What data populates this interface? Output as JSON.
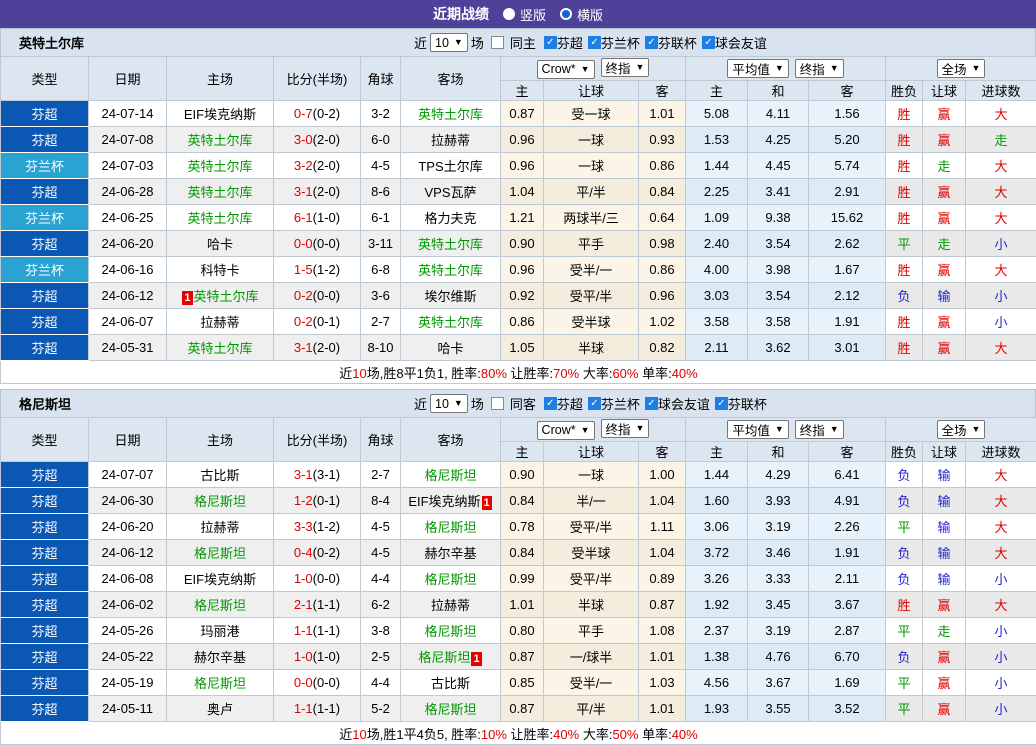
{
  "titlebar": {
    "title": "近期战绩",
    "options": [
      {
        "label": "竖版",
        "selected": false
      },
      {
        "label": "横版",
        "selected": true
      }
    ]
  },
  "colors": {
    "titlebar_purple": "#4e4199",
    "league_super_blue": "#0b57b4",
    "league_cup_blue": "#2aa3d2",
    "focus_team_green": "#009900",
    "win_red": "#e00000",
    "draw_green": "#009900",
    "lose_blue": "#2222cc",
    "checkbox_blue": "#1d7fe3"
  },
  "columns": {
    "type": "类型",
    "date": "日期",
    "home": "主场",
    "score": "比分(半场)",
    "corner": "角球",
    "away": "客场",
    "odds_sub": [
      "主",
      "让球",
      "客"
    ],
    "avg_sub": [
      "主",
      "和",
      "客"
    ],
    "result_sub": [
      "胜负",
      "让球",
      "进球数"
    ]
  },
  "selects": {
    "bookmaker": "Crow*",
    "final": "终指",
    "average": "平均值",
    "scope": "全场"
  },
  "sections": [
    {
      "team": "英特土尔库",
      "filter": {
        "near": "近",
        "count": "10",
        "games": "场",
        "same": "同主",
        "leagues": [
          "芬超",
          "芬兰杯",
          "芬联杯",
          "球会友谊"
        ]
      },
      "rows": [
        {
          "lg": "芬超",
          "cup": false,
          "date": "24-07-14",
          "home": {
            "n": "EIF埃克纳斯",
            "g": false
          },
          "score": "0-7",
          "half": "(0-2)",
          "corner": "3-2",
          "away": {
            "n": "英特土尔库",
            "g": true
          },
          "o": [
            "0.87",
            "受一球",
            "1.01"
          ],
          "a": [
            "5.08",
            "4.11",
            "1.56"
          ],
          "res": [
            [
              "胜",
              "r"
            ],
            [
              "赢",
              "r"
            ],
            [
              "大",
              "r"
            ]
          ]
        },
        {
          "lg": "芬超",
          "cup": false,
          "date": "24-07-08",
          "home": {
            "n": "英特土尔库",
            "g": true
          },
          "score": "3-0",
          "half": "(2-0)",
          "corner": "6-0",
          "away": {
            "n": "拉赫蒂",
            "g": false
          },
          "o": [
            "0.96",
            "一球",
            "0.93"
          ],
          "a": [
            "1.53",
            "4.25",
            "5.20"
          ],
          "res": [
            [
              "胜",
              "r"
            ],
            [
              "赢",
              "r"
            ],
            [
              "走",
              "g"
            ]
          ]
        },
        {
          "lg": "芬兰杯",
          "cup": true,
          "date": "24-07-03",
          "home": {
            "n": "英特土尔库",
            "g": true
          },
          "score": "3-2",
          "half": "(2-0)",
          "corner": "4-5",
          "away": {
            "n": "TPS土尔库",
            "g": false
          },
          "o": [
            "0.96",
            "一球",
            "0.86"
          ],
          "a": [
            "1.44",
            "4.45",
            "5.74"
          ],
          "res": [
            [
              "胜",
              "r"
            ],
            [
              "走",
              "g"
            ],
            [
              "大",
              "r"
            ]
          ]
        },
        {
          "lg": "芬超",
          "cup": false,
          "date": "24-06-28",
          "home": {
            "n": "英特土尔库",
            "g": true
          },
          "score": "3-1",
          "half": "(2-0)",
          "corner": "8-6",
          "away": {
            "n": "VPS瓦萨",
            "g": false
          },
          "o": [
            "1.04",
            "平/半",
            "0.84"
          ],
          "a": [
            "2.25",
            "3.41",
            "2.91"
          ],
          "res": [
            [
              "胜",
              "r"
            ],
            [
              "赢",
              "r"
            ],
            [
              "大",
              "r"
            ]
          ]
        },
        {
          "lg": "芬兰杯",
          "cup": true,
          "date": "24-06-25",
          "home": {
            "n": "英特土尔库",
            "g": true
          },
          "score": "6-1",
          "half": "(1-0)",
          "corner": "6-1",
          "away": {
            "n": "格力夫克",
            "g": false
          },
          "o": [
            "1.21",
            "两球半/三",
            "0.64"
          ],
          "a": [
            "1.09",
            "9.38",
            "15.62"
          ],
          "res": [
            [
              "胜",
              "r"
            ],
            [
              "赢",
              "r"
            ],
            [
              "大",
              "r"
            ]
          ]
        },
        {
          "lg": "芬超",
          "cup": false,
          "date": "24-06-20",
          "home": {
            "n": "哈卡",
            "g": false
          },
          "score": "0-0",
          "half": "(0-0)",
          "corner": "3-11",
          "away": {
            "n": "英特土尔库",
            "g": true
          },
          "o": [
            "0.90",
            "平手",
            "0.98"
          ],
          "a": [
            "2.40",
            "3.54",
            "2.62"
          ],
          "res": [
            [
              "平",
              "g"
            ],
            [
              "走",
              "g"
            ],
            [
              "小",
              "b"
            ]
          ]
        },
        {
          "lg": "芬兰杯",
          "cup": true,
          "date": "24-06-16",
          "home": {
            "n": "科特卡",
            "g": false
          },
          "score": "1-5",
          "half": "(1-2)",
          "corner": "6-8",
          "away": {
            "n": "英特土尔库",
            "g": true
          },
          "o": [
            "0.96",
            "受半/一",
            "0.86"
          ],
          "a": [
            "4.00",
            "3.98",
            "1.67"
          ],
          "res": [
            [
              "胜",
              "r"
            ],
            [
              "赢",
              "r"
            ],
            [
              "大",
              "r"
            ]
          ]
        },
        {
          "lg": "芬超",
          "cup": false,
          "date": "24-06-12",
          "home": {
            "n": "英特土尔库",
            "g": true,
            "card": "1",
            "cpos": "b"
          },
          "score": "0-2",
          "half": "(0-0)",
          "corner": "3-6",
          "away": {
            "n": "埃尔维斯",
            "g": false
          },
          "o": [
            "0.92",
            "受平/半",
            "0.96"
          ],
          "a": [
            "3.03",
            "3.54",
            "2.12"
          ],
          "res": [
            [
              "负",
              "b"
            ],
            [
              "输",
              "b"
            ],
            [
              "小",
              "b"
            ]
          ]
        },
        {
          "lg": "芬超",
          "cup": false,
          "date": "24-06-07",
          "home": {
            "n": "拉赫蒂",
            "g": false
          },
          "score": "0-2",
          "half": "(0-1)",
          "corner": "2-7",
          "away": {
            "n": "英特土尔库",
            "g": true
          },
          "o": [
            "0.86",
            "受半球",
            "1.02"
          ],
          "a": [
            "3.58",
            "3.58",
            "1.91"
          ],
          "res": [
            [
              "胜",
              "r"
            ],
            [
              "赢",
              "r"
            ],
            [
              "小",
              "b"
            ]
          ]
        },
        {
          "lg": "芬超",
          "cup": false,
          "date": "24-05-31",
          "home": {
            "n": "英特土尔库",
            "g": true
          },
          "score": "3-1",
          "half": "(2-0)",
          "corner": "8-10",
          "away": {
            "n": "哈卡",
            "g": false
          },
          "o": [
            "1.05",
            "半球",
            "0.82"
          ],
          "a": [
            "2.11",
            "3.62",
            "3.01"
          ],
          "res": [
            [
              "胜",
              "r"
            ],
            [
              "赢",
              "r"
            ],
            [
              "大",
              "r"
            ]
          ]
        }
      ],
      "summary": [
        {
          "t": "近",
          "red": false
        },
        {
          "t": "10",
          "red": true
        },
        {
          "t": "场,胜8平1负1, 胜率:",
          "red": false
        },
        {
          "t": "80%",
          "red": true
        },
        {
          "t": " 让胜率:",
          "red": false
        },
        {
          "t": "70%",
          "red": true
        },
        {
          "t": " 大率:",
          "red": false
        },
        {
          "t": "60%",
          "red": true
        },
        {
          "t": " 单率:",
          "red": false
        },
        {
          "t": "40%",
          "red": true
        }
      ]
    },
    {
      "team": "格尼斯坦",
      "filter": {
        "near": "近",
        "count": "10",
        "games": "场",
        "same": "同客",
        "leagues": [
          "芬超",
          "芬兰杯",
          "球会友谊",
          "芬联杯"
        ]
      },
      "rows": [
        {
          "lg": "芬超",
          "cup": false,
          "date": "24-07-07",
          "home": {
            "n": "古比斯",
            "g": false
          },
          "score": "3-1",
          "half": "(3-1)",
          "corner": "2-7",
          "away": {
            "n": "格尼斯坦",
            "g": true
          },
          "o": [
            "0.90",
            "一球",
            "1.00"
          ],
          "a": [
            "1.44",
            "4.29",
            "6.41"
          ],
          "res": [
            [
              "负",
              "b"
            ],
            [
              "输",
              "b"
            ],
            [
              "大",
              "r"
            ]
          ]
        },
        {
          "lg": "芬超",
          "cup": false,
          "date": "24-06-30",
          "home": {
            "n": "格尼斯坦",
            "g": true
          },
          "score": "1-2",
          "half": "(0-1)",
          "corner": "8-4",
          "away": {
            "n": "EIF埃克纳斯",
            "g": false,
            "card": "1",
            "cpos": "a"
          },
          "o": [
            "0.84",
            "半/一",
            "1.04"
          ],
          "a": [
            "1.60",
            "3.93",
            "4.91"
          ],
          "res": [
            [
              "负",
              "b"
            ],
            [
              "输",
              "b"
            ],
            [
              "大",
              "r"
            ]
          ]
        },
        {
          "lg": "芬超",
          "cup": false,
          "date": "24-06-20",
          "home": {
            "n": "拉赫蒂",
            "g": false
          },
          "score": "3-3",
          "half": "(1-2)",
          "corner": "4-5",
          "away": {
            "n": "格尼斯坦",
            "g": true
          },
          "o": [
            "0.78",
            "受平/半",
            "1.11"
          ],
          "a": [
            "3.06",
            "3.19",
            "2.26"
          ],
          "res": [
            [
              "平",
              "g"
            ],
            [
              "输",
              "b"
            ],
            [
              "大",
              "r"
            ]
          ]
        },
        {
          "lg": "芬超",
          "cup": false,
          "date": "24-06-12",
          "home": {
            "n": "格尼斯坦",
            "g": true
          },
          "score": "0-4",
          "half": "(0-2)",
          "corner": "4-5",
          "away": {
            "n": "赫尔辛基",
            "g": false
          },
          "o": [
            "0.84",
            "受半球",
            "1.04"
          ],
          "a": [
            "3.72",
            "3.46",
            "1.91"
          ],
          "res": [
            [
              "负",
              "b"
            ],
            [
              "输",
              "b"
            ],
            [
              "大",
              "r"
            ]
          ]
        },
        {
          "lg": "芬超",
          "cup": false,
          "date": "24-06-08",
          "home": {
            "n": "EIF埃克纳斯",
            "g": false
          },
          "score": "1-0",
          "half": "(0-0)",
          "corner": "4-4",
          "away": {
            "n": "格尼斯坦",
            "g": true
          },
          "o": [
            "0.99",
            "受平/半",
            "0.89"
          ],
          "a": [
            "3.26",
            "3.33",
            "2.11"
          ],
          "res": [
            [
              "负",
              "b"
            ],
            [
              "输",
              "b"
            ],
            [
              "小",
              "b"
            ]
          ]
        },
        {
          "lg": "芬超",
          "cup": false,
          "date": "24-06-02",
          "home": {
            "n": "格尼斯坦",
            "g": true
          },
          "score": "2-1",
          "half": "(1-1)",
          "corner": "6-2",
          "away": {
            "n": "拉赫蒂",
            "g": false
          },
          "o": [
            "1.01",
            "半球",
            "0.87"
          ],
          "a": [
            "1.92",
            "3.45",
            "3.67"
          ],
          "res": [
            [
              "胜",
              "r"
            ],
            [
              "赢",
              "r"
            ],
            [
              "大",
              "r"
            ]
          ]
        },
        {
          "lg": "芬超",
          "cup": false,
          "date": "24-05-26",
          "home": {
            "n": "玛丽港",
            "g": false
          },
          "score": "1-1",
          "half": "(1-1)",
          "corner": "3-8",
          "away": {
            "n": "格尼斯坦",
            "g": true
          },
          "o": [
            "0.80",
            "平手",
            "1.08"
          ],
          "a": [
            "2.37",
            "3.19",
            "2.87"
          ],
          "res": [
            [
              "平",
              "g"
            ],
            [
              "走",
              "g"
            ],
            [
              "小",
              "b"
            ]
          ]
        },
        {
          "lg": "芬超",
          "cup": false,
          "date": "24-05-22",
          "home": {
            "n": "赫尔辛基",
            "g": false
          },
          "score": "1-0",
          "half": "(1-0)",
          "corner": "2-5",
          "away": {
            "n": "格尼斯坦",
            "g": true,
            "card": "1",
            "cpos": "a"
          },
          "o": [
            "0.87",
            "一/球半",
            "1.01"
          ],
          "a": [
            "1.38",
            "4.76",
            "6.70"
          ],
          "res": [
            [
              "负",
              "b"
            ],
            [
              "赢",
              "r"
            ],
            [
              "小",
              "b"
            ]
          ]
        },
        {
          "lg": "芬超",
          "cup": false,
          "date": "24-05-19",
          "home": {
            "n": "格尼斯坦",
            "g": true
          },
          "score": "0-0",
          "half": "(0-0)",
          "corner": "4-4",
          "away": {
            "n": "古比斯",
            "g": false
          },
          "o": [
            "0.85",
            "受半/一",
            "1.03"
          ],
          "a": [
            "4.56",
            "3.67",
            "1.69"
          ],
          "res": [
            [
              "平",
              "g"
            ],
            [
              "赢",
              "r"
            ],
            [
              "小",
              "b"
            ]
          ]
        },
        {
          "lg": "芬超",
          "cup": false,
          "date": "24-05-11",
          "home": {
            "n": "奥卢",
            "g": false
          },
          "score": "1-1",
          "half": "(1-1)",
          "corner": "5-2",
          "away": {
            "n": "格尼斯坦",
            "g": true
          },
          "o": [
            "0.87",
            "平/半",
            "1.01"
          ],
          "a": [
            "1.93",
            "3.55",
            "3.52"
          ],
          "res": [
            [
              "平",
              "g"
            ],
            [
              "赢",
              "r"
            ],
            [
              "小",
              "b"
            ]
          ]
        }
      ],
      "summary": [
        {
          "t": "近",
          "red": false
        },
        {
          "t": "10",
          "red": true
        },
        {
          "t": "场,胜1平4负5, 胜率:",
          "red": false
        },
        {
          "t": "10%",
          "red": true
        },
        {
          "t": " 让胜率:",
          "red": false
        },
        {
          "t": "40%",
          "red": true
        },
        {
          "t": " 大率:",
          "red": false
        },
        {
          "t": "50%",
          "red": true
        },
        {
          "t": " 单率:",
          "red": false
        },
        {
          "t": "40%",
          "red": true
        }
      ]
    }
  ]
}
